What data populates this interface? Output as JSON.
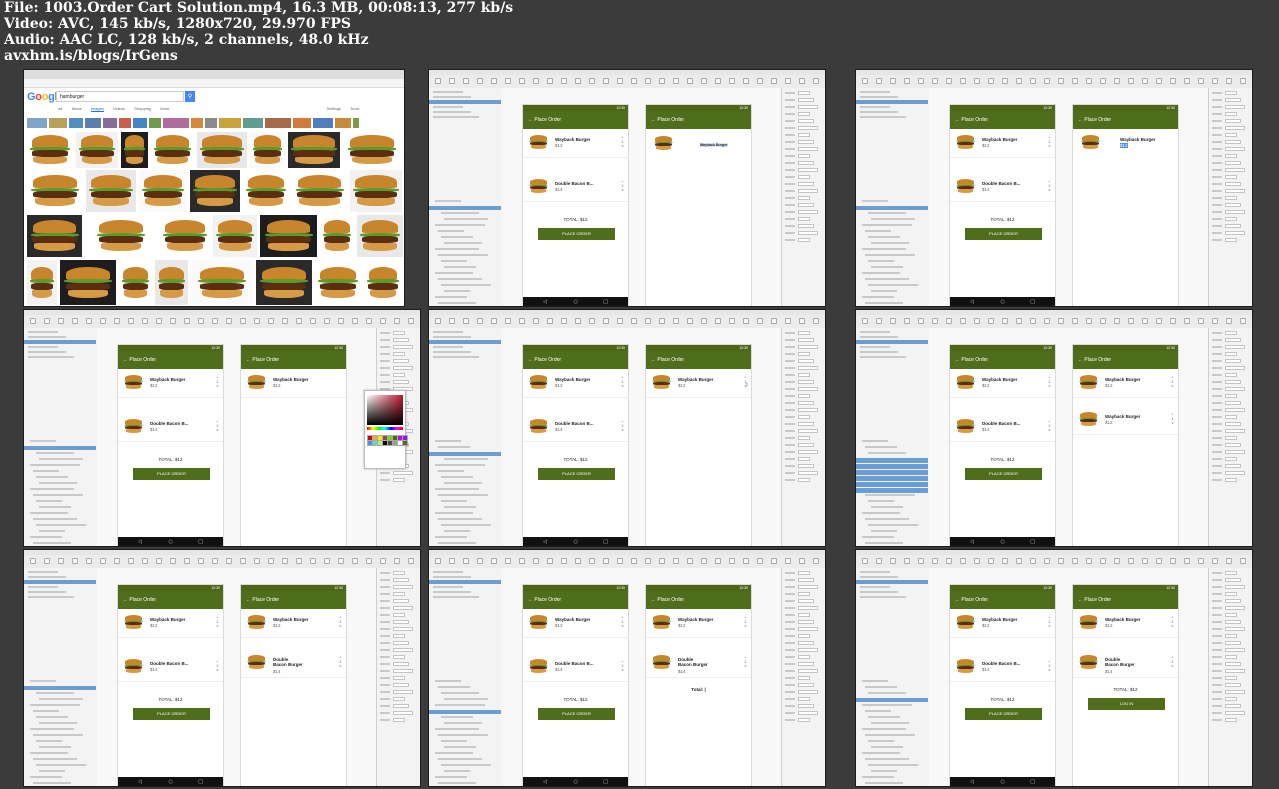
{
  "header": {
    "file_line": "File: 1003.Order Cart Solution.mp4, 16.3 MB, 00:08:13, 277 kb/s",
    "video_line": "Video: AVC, 145 kb/s, 1280x720, 29.970 FPS",
    "audio_line": "Audio: AAC LC, 128 kb/s, 2 channels, 48.0 kHz",
    "site_line": "avxhm.is/blogs/IrGens"
  },
  "google": {
    "logo": "Google",
    "query": "hamburger",
    "tabs": [
      "All",
      "News",
      "Images",
      "Videos",
      "Shopping",
      "More",
      "Settings",
      "Tools"
    ],
    "active_tab": "Images",
    "chip_colors": [
      "#7fa5c9",
      "#b7a15a",
      "#4e8fbf",
      "#5a7fae",
      "#8a6a9a",
      "#c85f4f",
      "#3f86c4",
      "#6e9c4a",
      "#b06ca1",
      "#d48a3a",
      "#8a8a8a",
      "#c9a23a",
      "#5f9e8f",
      "#a66a4a",
      "#d27a3a",
      "#4f7fbf",
      "#c98a3a",
      "#7a9a4a"
    ]
  },
  "sketch": {
    "appbar_title": "Place Order",
    "status_time": "12:30",
    "items": [
      {
        "name": "Wayback Burger",
        "price": "$12"
      },
      {
        "name": "Double Bacon B...",
        "price": "$14"
      }
    ],
    "item_name_full": "Double Bacon Burger",
    "total": "TOTAL: $12",
    "total_partial": "Total: |",
    "button": "PLACE ORDER",
    "button_login": "LOG IN",
    "qty": "1",
    "qty2": "2",
    "stepper_up": "^",
    "stepper_down": "v",
    "nav_back": "◁",
    "nav_home": "○",
    "nav_recent": "□",
    "back_arrow": "←"
  },
  "colors": {
    "appbar": "#4f6e1c",
    "status": "#4a6818",
    "selection": "#6a9cd6"
  }
}
